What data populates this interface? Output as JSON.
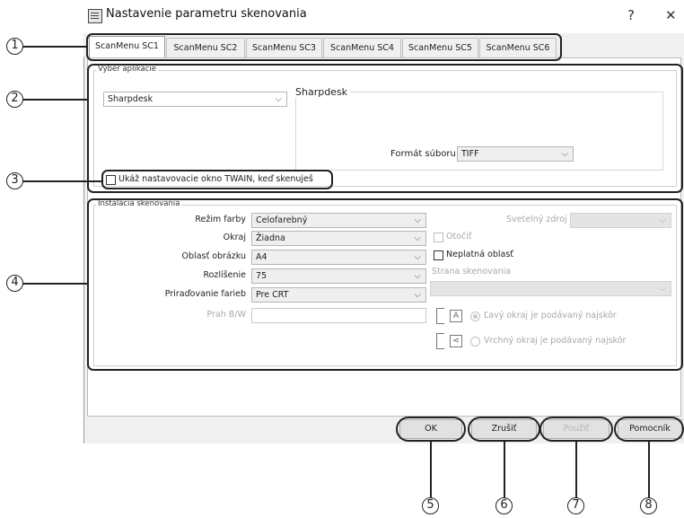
{
  "window": {
    "title": "Nastavenie parametru skenovania",
    "help_button": "?",
    "close_button": "✕"
  },
  "tabs": [
    {
      "label": "ScanMenu SC1",
      "active": true
    },
    {
      "label": "ScanMenu SC2",
      "active": false
    },
    {
      "label": "ScanMenu SC3",
      "active": false
    },
    {
      "label": "ScanMenu SC4",
      "active": false
    },
    {
      "label": "ScanMenu SC5",
      "active": false
    },
    {
      "label": "ScanMenu SC6",
      "active": false
    }
  ],
  "app_selection": {
    "group_label": "Výber aplikácie",
    "app_combo_value": "Sharpdesk",
    "app_group_title": "Sharpdesk",
    "file_format_label": "Formát súboru",
    "file_format_value": "TIFF",
    "twain_checkbox_label": "Ukáž nastavovacie okno TWAIN, keď skenuješ",
    "twain_checked": false
  },
  "scan_settings": {
    "group_label": "Inštalácia skenovania",
    "color_mode_label": "Režim farby",
    "color_mode_value": "Celofarebný",
    "edge_label": "Okraj",
    "edge_value": "Žiadna",
    "image_area_label": "Oblasť obrázku",
    "image_area_value": "A4",
    "resolution_label": "Rozlíšenie",
    "resolution_value": "75",
    "color_assign_label": "Priraďovanie farieb",
    "color_assign_value": "Pre CRT",
    "bw_threshold_label": "Prah B/W",
    "bw_threshold_value": "",
    "light_source_label": "Svetelný zdroj",
    "rotate_label": "Otočiť",
    "invalid_area_label": "Neplatná oblasť",
    "scan_side_label": "Strana skenovania",
    "left_edge_radio_label": "Ľavý okraj je podávaný najskôr",
    "top_edge_radio_label": "Vrchný okraj je podávaný najskôr",
    "orient_a_glyph": "A",
    "orient_b_glyph": "⋖"
  },
  "buttons": {
    "ok": "OK",
    "cancel": "Zrušiť",
    "apply": "Použiť",
    "help": "Pomocník"
  },
  "callouts": [
    "1",
    "2",
    "3",
    "4",
    "5",
    "6",
    "7",
    "8"
  ],
  "icons": {
    "dropdown": "chevron-down-icon",
    "window": "scanner-window-icon"
  }
}
